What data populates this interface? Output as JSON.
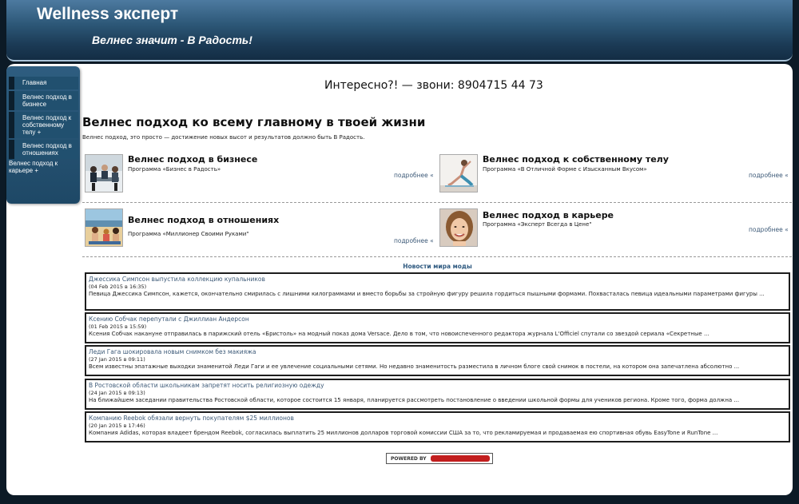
{
  "header": {
    "site_title": "Wellness эксперт",
    "slogan": "Велнес значит - В Радость!"
  },
  "sidebar": {
    "items": [
      {
        "label": "Главная"
      },
      {
        "label": "Велнес подход в бизнесе"
      },
      {
        "label": "Велнес подход к собственному телу +"
      },
      {
        "label": "Велнес подход в отношениях"
      },
      {
        "label": "Велнес подход к карьере +"
      }
    ]
  },
  "main": {
    "phone_line": "Интересно?! — звони: 8904715 44 73",
    "heading": "Велнес подход ко всему главному в твоей жизни",
    "intro": "Велнес подход, это просто — достижение новых высот и результатов должно быть В Радость.",
    "more_label": "подробнее «",
    "cards": [
      {
        "title": "Велнес подход в бизнесе",
        "subtitle": "Программа «Бизнес в Радость»",
        "image": "business-meeting-photo"
      },
      {
        "title": "Велнес подход к собственному телу",
        "subtitle": "Программа «В Отличной Форме с Изысканным Вкусом»",
        "image": "yoga-photo"
      },
      {
        "title": "Велнес подход в отношениях",
        "subtitle": "Программа «Миллионер Своими Руками\"",
        "image": "beach-family-photo"
      },
      {
        "title": "Велнес подход в карьере",
        "subtitle": "Программа «Эксперт Всегда в Цене\"",
        "image": "smiling-woman-photo"
      }
    ]
  },
  "news": {
    "heading": "Новости мира моды",
    "items": [
      {
        "title": "Джессика Симпсон выпустила коллекцию купальников",
        "date": "(04 Feb 2015 в 16:35)",
        "text": "Певица Джессика Симпсон, кажется, окончательно смирилась с лишними килограммами и вместо борьбы за стройную фигуру решила гордиться пышными формами. Похвасталась певица идеальными параметрами фигуры ..."
      },
      {
        "title": "Ксению Собчак перепутали с Джиллиан Андерсон",
        "date": "(01 Feb 2015 в 15:59)",
        "text": "Ксения Собчак накануне отправилась в парижский отель «Бристоль» на модный показ дома Versace. Дело в том, что новоиспеченного редактора журнала L'Officiel спутали со звездой сериала «Секретные ..."
      },
      {
        "title": "Леди Гага шокировала новым снимком без макияжа",
        "date": "(27 Jan 2015 в 09:11)",
        "text": "Всем известны эпатажные выходки знаменитой Леди Гаги и ее увлечение социальными сетями. Но недавно знаменитость разместила в личном блоге свой снимок в постели, на котором она запечатлена абсолютно ..."
      },
      {
        "title": "В Ростовской области школьникам запретят носить религиозную одежду",
        "date": "(24 Jan 2015 в 09:13)",
        "text": "На ближайшем заседании правительства Ростовской области, которое состоится 15 января, планируется рассмотреть постановление о введении школьной формы для учеников региона. Кроме того, форма должна ..."
      },
      {
        "title": "Компанию Reebok обязали вернуть покупателям $25 миллионов",
        "date": "(20 Jan 2015 в 17:46)",
        "text": "Компания Adidas, которая владеет брендом Reebok, согласилась выплатить 25 миллионов долларов торговой комиссии США за то, что рекламируемая и продаваемая ею спортивная обувь EasyTone и RunTone ..."
      }
    ]
  },
  "footer": {
    "powered_label": "POWERED BY"
  },
  "colors": {
    "header_dark": "#1b3a55",
    "link": "#3d5a78",
    "logo_red": "#c21e1e"
  }
}
